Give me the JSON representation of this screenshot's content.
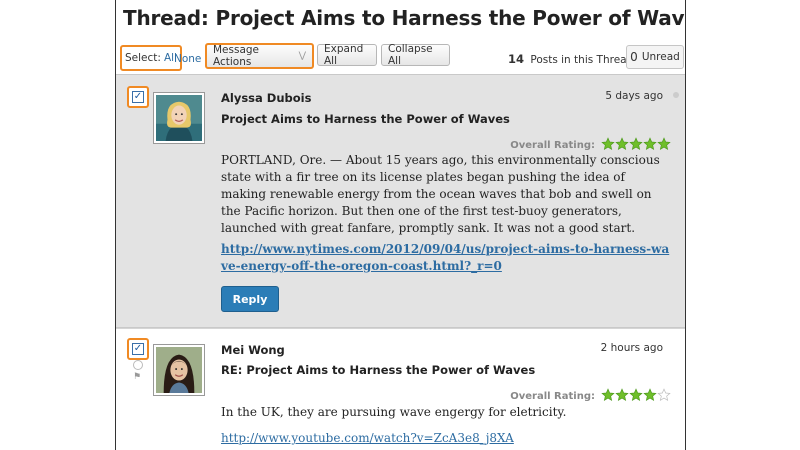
{
  "thread": {
    "title": "Thread: Project Aims to Harness the Power of Waves",
    "posts_count": "14",
    "posts_label": "Posts in this Thread",
    "unread_count": "0",
    "unread_label": "Unread"
  },
  "toolbar": {
    "select_label": "Select:",
    "select_all": "All",
    "select_none": "None",
    "message_actions": "Message Actions",
    "expand_all": "Expand All",
    "collapse_all": "Collapse All"
  },
  "colors": {
    "highlight": "#f08a24",
    "link": "#2d6ca2",
    "reply": "#2b7db7",
    "star": "#6fbf2a"
  },
  "posts": [
    {
      "author": "Alyssa Dubois",
      "time": "5 days ago",
      "subject": "Project Aims to Harness the Power of Waves",
      "rating_label": "Overall Rating:",
      "rating": 5,
      "body": "PORTLAND, Ore. — About 15 years ago, this environmentally conscious state with a fir tree on its license plates began pushing the idea of making renewable energy from the ocean waves that bob and swell on the Pacific horizon. But then one of the first test-buoy generators, launched with great fanfare, promptly sank. It was not a good start.",
      "link": "http://www.nytimes.com/2012/09/04/us/project-aims-to-harness-wave-energy-off-the-oregon-coast.html?_r=0",
      "reply_label": "Reply"
    },
    {
      "author": "Mei Wong",
      "time": "2 hours ago",
      "subject": "RE: Project Aims to Harness the Power of Waves",
      "rating_label": "Overall Rating:",
      "rating": 4,
      "body": "In the UK, they are pursuing wave engergy for eletricity.",
      "link": "http://www.youtube.com/watch?v=ZcA3e8_j8XA"
    }
  ]
}
